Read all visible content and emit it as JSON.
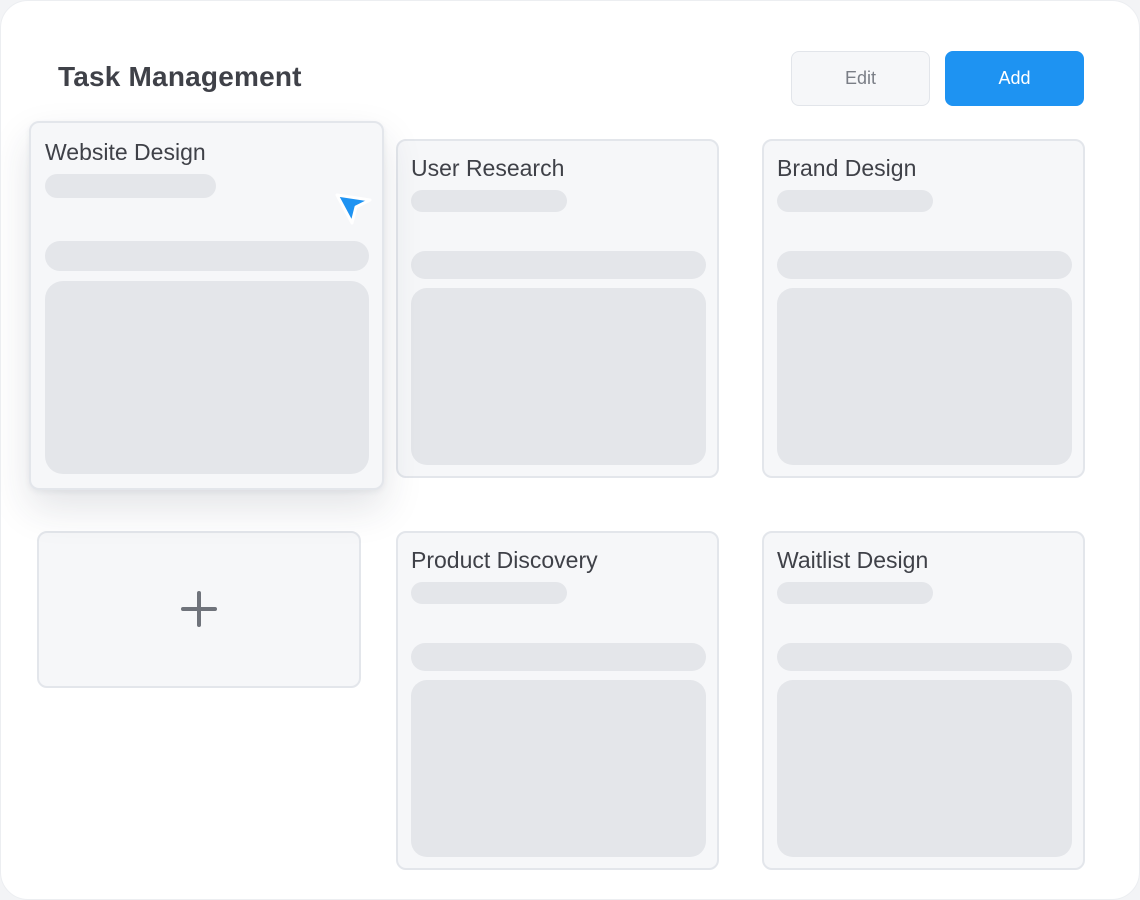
{
  "header": {
    "title": "Task Management",
    "edit_label": "Edit",
    "add_label": "Add"
  },
  "colors": {
    "accent": "#1e93f2",
    "card_background": "#f6f7f9",
    "skeleton": "#e4e6ea",
    "text": "#3f4148"
  },
  "cards": [
    {
      "title": "Website Design",
      "state": "dragging"
    },
    {
      "title": "User Research"
    },
    {
      "title": "Brand Design"
    },
    {
      "title": "Product Discovery"
    },
    {
      "title": "Waitlist Design"
    }
  ],
  "icons": {
    "add_card": "plus-icon",
    "pointer": "cursor-icon"
  }
}
